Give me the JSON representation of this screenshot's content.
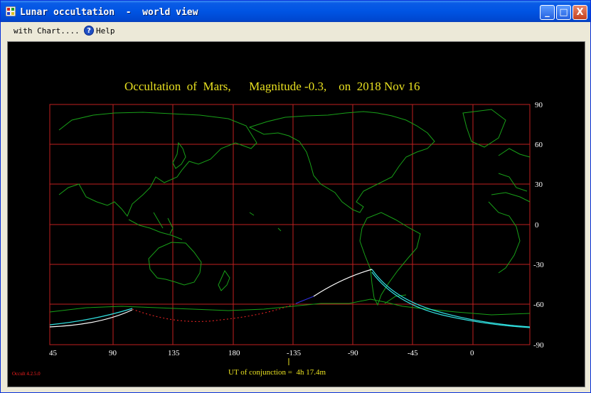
{
  "window": {
    "title": "Lunar occultation  -  world view",
    "buttons": [
      "_",
      "□",
      "X"
    ]
  },
  "menu": {
    "chart_label": "with Chart....",
    "help_label": "Help"
  },
  "chart": {
    "title": "Occultation  of  Mars,      Magnitude -0.3,    on  2018 Nov 16",
    "longitude_labels": [
      "45",
      "90",
      "135",
      "180",
      "-135",
      "-90",
      "-45",
      "0"
    ],
    "latitude_labels": [
      "90",
      "60",
      "30",
      "0",
      "-30",
      "-60",
      "-90"
    ],
    "conjunction_text": "UT of conjunction =  4h 17.4m",
    "version_text": "Occult 4.2.5.0"
  },
  "colors": {
    "title": "#e8e020",
    "grid": "#c02020",
    "coast": "#18a018",
    "path_white": "#ffffff",
    "path_cyan": "#30e0e0",
    "path_dotted": "#d02020",
    "path_blue": "#3030e0",
    "axis_text": "#ffffff",
    "version": "#ff2020"
  }
}
